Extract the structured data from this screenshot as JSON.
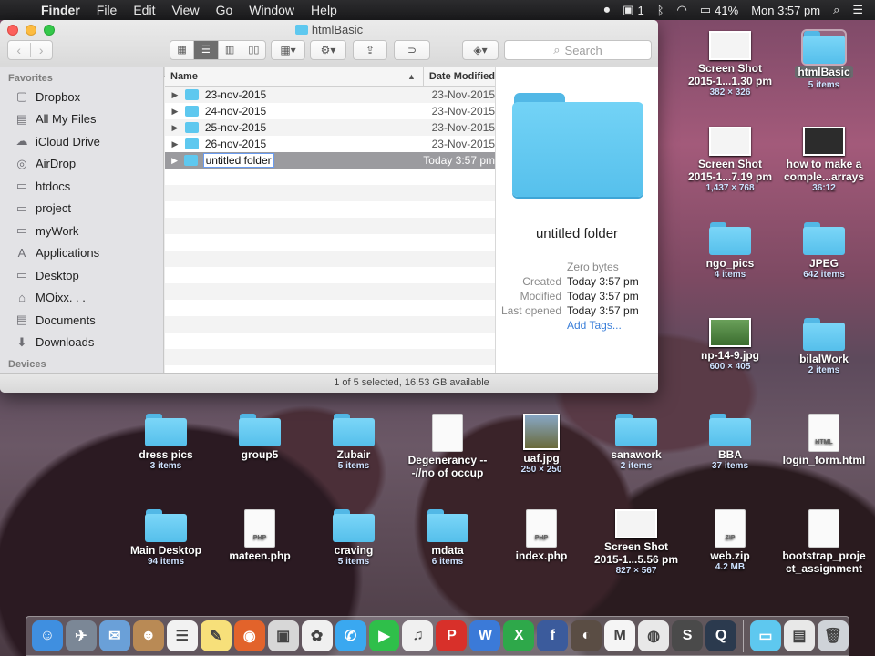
{
  "menubar": {
    "app": "Finder",
    "items": [
      "File",
      "Edit",
      "View",
      "Go",
      "Window",
      "Help"
    ],
    "status": {
      "notification_count": "1",
      "battery": "41%",
      "clock": "Mon 3:57 pm"
    }
  },
  "window": {
    "title": "htmlBasic",
    "search_placeholder": "Search",
    "sidebar": {
      "favorites_header": "Favorites",
      "devices_header": "Devices",
      "items": [
        {
          "label": "Dropbox",
          "icon": "dropbox-icon",
          "glyph": "▢"
        },
        {
          "label": "All My Files",
          "icon": "all-files-icon",
          "glyph": "▤"
        },
        {
          "label": "iCloud Drive",
          "icon": "cloud-icon",
          "glyph": "☁"
        },
        {
          "label": "AirDrop",
          "icon": "airdrop-icon",
          "glyph": "◎"
        },
        {
          "label": "htdocs",
          "icon": "folder-icon",
          "glyph": "▭"
        },
        {
          "label": "project",
          "icon": "folder-icon",
          "glyph": "▭"
        },
        {
          "label": "myWork",
          "icon": "folder-icon",
          "glyph": "▭"
        },
        {
          "label": "Applications",
          "icon": "applications-icon",
          "glyph": "A"
        },
        {
          "label": "Desktop",
          "icon": "desktop-icon",
          "glyph": "▭"
        },
        {
          "label": "MOixx. . .",
          "icon": "home-icon",
          "glyph": "⌂"
        },
        {
          "label": "Documents",
          "icon": "documents-icon",
          "glyph": "▤"
        },
        {
          "label": "Downloads",
          "icon": "downloads-icon",
          "glyph": "⬇"
        }
      ]
    },
    "columns": {
      "name": "Name",
      "date": "Date Modified"
    },
    "rows": [
      {
        "name": "23-nov-2015",
        "date": "23-Nov-2015"
      },
      {
        "name": "24-nov-2015",
        "date": "23-Nov-2015"
      },
      {
        "name": "25-nov-2015",
        "date": "23-Nov-2015"
      },
      {
        "name": "26-nov-2015",
        "date": "23-Nov-2015"
      },
      {
        "name": "untitled folder",
        "date": "Today 3:57 pm",
        "selected": true
      }
    ],
    "preview": {
      "name": "untitled folder",
      "size": "Zero bytes",
      "created_label": "Created",
      "created": "Today 3:57 pm",
      "modified_label": "Modified",
      "modified": "Today 3:57 pm",
      "opened_label": "Last opened",
      "opened": "Today 3:57 pm",
      "add_tags": "Add Tags..."
    },
    "status": "1 of 5 selected, 16.53 GB available"
  },
  "desktop": [
    {
      "name": "Screen Shot 2015-1...1.30 pm",
      "sub": "382 × 326",
      "kind": "shot"
    },
    {
      "name": "htmlBasic",
      "sub": "5 items",
      "kind": "folder",
      "selected": true
    },
    {
      "name": "Screen Shot 2015-1...7.19 pm",
      "sub": "1,437 × 768",
      "kind": "shot"
    },
    {
      "name": "how to make a comple...arrays",
      "sub": "36:12",
      "kind": "shot-dark"
    },
    {
      "name": "ngo_pics",
      "sub": "4 items",
      "kind": "folder"
    },
    {
      "name": "JPEG",
      "sub": "642 items",
      "kind": "folder"
    },
    {
      "name": "np-14-9.jpg",
      "sub": "600 × 405",
      "kind": "shot-green"
    },
    {
      "name": "bilalWork",
      "sub": "2 items",
      "kind": "folder"
    },
    {
      "name": "dress pics",
      "sub": "3 items",
      "kind": "folder"
    },
    {
      "name": "group5",
      "sub": "",
      "kind": "folder"
    },
    {
      "name": "Zubair",
      "sub": "5 items",
      "kind": "folder"
    },
    {
      "name": "Degenerancy ---//no of occup",
      "sub": "",
      "kind": "doc"
    },
    {
      "name": "uaf.jpg",
      "sub": "250 × 250",
      "kind": "campus"
    },
    {
      "name": "sanawork",
      "sub": "2 items",
      "kind": "folder"
    },
    {
      "name": "BBA",
      "sub": "37 items",
      "kind": "folder"
    },
    {
      "name": "login_form.html",
      "sub": "",
      "kind": "doc",
      "ext": "HTML"
    },
    {
      "name": "Main Desktop",
      "sub": "94 items",
      "kind": "folder"
    },
    {
      "name": "mateen.php",
      "sub": "",
      "kind": "doc",
      "ext": "PHP"
    },
    {
      "name": "craving",
      "sub": "5 items",
      "kind": "folder"
    },
    {
      "name": "mdata",
      "sub": "6 items",
      "kind": "folder"
    },
    {
      "name": "index.php",
      "sub": "",
      "kind": "doc",
      "ext": "PHP"
    },
    {
      "name": "Screen Shot 2015-1...5.56 pm",
      "sub": "827 × 567",
      "kind": "shot"
    },
    {
      "name": "web.zip",
      "sub": "4.2 MB",
      "kind": "doc",
      "ext": "ZIP"
    },
    {
      "name": "bootstrap_proje ct_assignment",
      "sub": "",
      "kind": "doc"
    }
  ],
  "dock": [
    {
      "name": "finder",
      "color": "#3f8fe0",
      "glyph": "☺"
    },
    {
      "name": "launchpad",
      "color": "#7b8796",
      "glyph": "✈"
    },
    {
      "name": "mail",
      "color": "#6aa0d8",
      "glyph": "✉"
    },
    {
      "name": "contacts",
      "color": "#b98a55",
      "glyph": "☻"
    },
    {
      "name": "reminders",
      "color": "#f2f2f2",
      "glyph": "☰"
    },
    {
      "name": "notes",
      "color": "#f7e07a",
      "glyph": "✎"
    },
    {
      "name": "firefox",
      "color": "#e2632b",
      "glyph": "◉"
    },
    {
      "name": "preview",
      "color": "#d7d7d7",
      "glyph": "▣"
    },
    {
      "name": "photos",
      "color": "#f0f0f0",
      "glyph": "✿"
    },
    {
      "name": "messages",
      "color": "#3aa8f0",
      "glyph": "✆"
    },
    {
      "name": "facetime",
      "color": "#2fbf4a",
      "glyph": "▶"
    },
    {
      "name": "itunes",
      "color": "#f0f0f0",
      "glyph": "♫"
    },
    {
      "name": "wps-presentation",
      "color": "#d8302a",
      "glyph": "P"
    },
    {
      "name": "wps-writer",
      "color": "#3b7ad8",
      "glyph": "W"
    },
    {
      "name": "wps-spreadsheet",
      "color": "#2ea84a",
      "glyph": "X"
    },
    {
      "name": "facebook",
      "color": "#3b5b9c",
      "glyph": "f"
    },
    {
      "name": "photo-app",
      "color": "#5a4d44",
      "glyph": "◐"
    },
    {
      "name": "gmail",
      "color": "#f5f5f5",
      "glyph": "M"
    },
    {
      "name": "sequel-pro",
      "color": "#e8e8e8",
      "glyph": "◍"
    },
    {
      "name": "sublime-text",
      "color": "#4a4a4a",
      "glyph": "S"
    },
    {
      "name": "quicktime",
      "color": "#2b3a4e",
      "glyph": "Q"
    },
    {
      "name": "downloads-stack",
      "color": "#5ec8ef",
      "glyph": "▭"
    },
    {
      "name": "documents-stack",
      "color": "#e8e8e8",
      "glyph": "▤"
    },
    {
      "name": "trash",
      "color": "#cfd3d8",
      "glyph": "🗑"
    }
  ]
}
